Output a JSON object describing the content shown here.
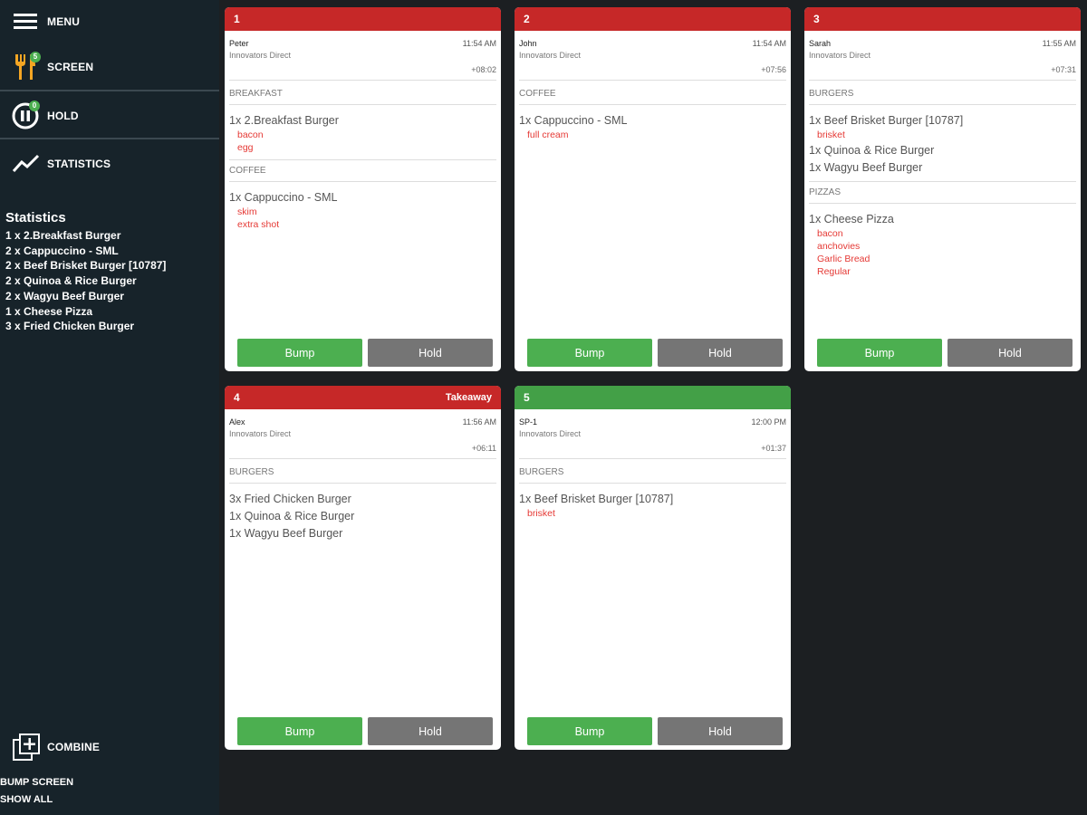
{
  "sidebar": {
    "menu_label": "MENU",
    "screen_label": "SCREEN",
    "screen_badge": "5",
    "hold_label": "HOLD",
    "hold_badge": "0",
    "statistics_label": "STATISTICS",
    "stats_title": "Statistics",
    "stats": [
      "1 x 2.Breakfast Burger",
      "2 x Cappuccino - SML",
      "2 x Beef Brisket Burger [10787]",
      "2 x Quinoa & Rice Burger",
      "2 x Wagyu Beef Burger",
      "1 x Cheese Pizza",
      "3 x Fried Chicken Burger"
    ],
    "combine_label": "COMBINE",
    "bump_screen_label": "BUMP SCREEN",
    "show_all_label": "SHOW ALL"
  },
  "colors": {
    "header_red": "#c62828",
    "header_green": "#43a047",
    "bump_green": "#4caf50",
    "hold_gray": "#757575",
    "modifier_red": "#e53935"
  },
  "tickets": [
    {
      "number": "1",
      "tag": "",
      "header_color": "red",
      "customer": "Peter",
      "time": "11:54 AM",
      "source": "Innovators Direct",
      "elapsed": "+08:02",
      "sections": [
        {
          "title": "BREAKFAST",
          "items": [
            {
              "text": "1x 2.Breakfast Burger",
              "mods": [
                "bacon",
                "egg"
              ]
            }
          ]
        },
        {
          "title": "COFFEE",
          "items": [
            {
              "text": "1x Cappuccino - SML",
              "mods": [
                "skim",
                "extra shot"
              ]
            }
          ]
        }
      ],
      "bump_label": "Bump",
      "hold_label": "Hold"
    },
    {
      "number": "2",
      "tag": "",
      "header_color": "red",
      "customer": "John",
      "time": "11:54 AM",
      "source": "Innovators Direct",
      "elapsed": "+07:56",
      "sections": [
        {
          "title": "COFFEE",
          "items": [
            {
              "text": "1x Cappuccino - SML",
              "mods": [
                "full cream"
              ]
            }
          ]
        }
      ],
      "bump_label": "Bump",
      "hold_label": "Hold"
    },
    {
      "number": "3",
      "tag": "",
      "header_color": "red",
      "customer": "Sarah",
      "time": "11:55 AM",
      "source": "Innovators Direct",
      "elapsed": "+07:31",
      "sections": [
        {
          "title": "BURGERS",
          "items": [
            {
              "text": "1x Beef Brisket Burger [10787]",
              "mods": [
                "brisket"
              ]
            },
            {
              "text": "1x Quinoa & Rice Burger",
              "mods": []
            },
            {
              "text": "1x Wagyu Beef Burger",
              "mods": []
            }
          ]
        },
        {
          "title": "PIZZAS",
          "items": [
            {
              "text": "1x Cheese Pizza",
              "mods": [
                "bacon",
                "anchovies",
                "Garlic Bread",
                "Regular"
              ]
            }
          ]
        }
      ],
      "bump_label": "Bump",
      "hold_label": "Hold"
    },
    {
      "number": "4",
      "tag": "Takeaway",
      "header_color": "red",
      "customer": "Alex",
      "time": "11:56 AM",
      "source": "Innovators Direct",
      "elapsed": "+06:11",
      "sections": [
        {
          "title": "BURGERS",
          "items": [
            {
              "text": "3x Fried Chicken Burger",
              "mods": []
            },
            {
              "text": "1x Quinoa & Rice Burger",
              "mods": []
            },
            {
              "text": "1x Wagyu Beef Burger",
              "mods": []
            }
          ]
        }
      ],
      "bump_label": "Bump",
      "hold_label": "Hold"
    },
    {
      "number": "5",
      "tag": "",
      "header_color": "green",
      "customer": "SP-1",
      "time": "12:00 PM",
      "source": "Innovators Direct",
      "elapsed": "+01:37",
      "sections": [
        {
          "title": "BURGERS",
          "items": [
            {
              "text": "1x Beef Brisket Burger [10787]",
              "mods": [
                "brisket"
              ]
            }
          ]
        }
      ],
      "bump_label": "Bump",
      "hold_label": "Hold"
    }
  ]
}
